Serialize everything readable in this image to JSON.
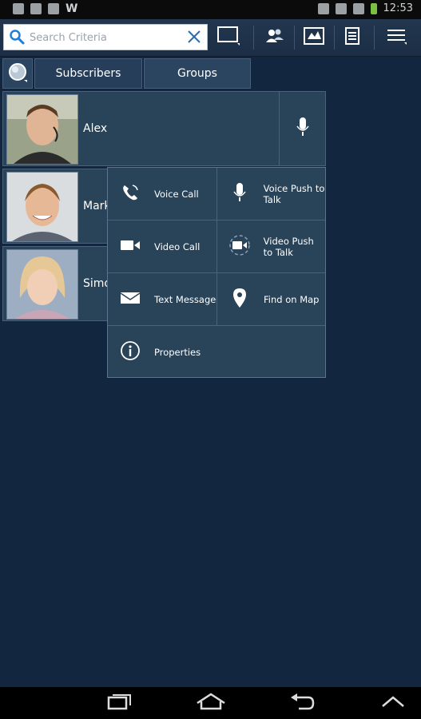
{
  "status_bar": {
    "time": "12:53"
  },
  "search": {
    "placeholder": "Search Criteria",
    "value": ""
  },
  "toolbar": {
    "buttons": [
      "window-icon",
      "people-icon",
      "map-icon",
      "list-icon",
      "menu-icon"
    ]
  },
  "tabs": [
    {
      "label": "Subscribers",
      "active": true
    },
    {
      "label": "Groups",
      "active": false
    }
  ],
  "subscribers": [
    {
      "name": "Alex"
    },
    {
      "name": "Mark"
    },
    {
      "name": "Simo"
    }
  ],
  "context_menu": {
    "items": [
      {
        "label": "Voice Call",
        "icon": "phone-icon"
      },
      {
        "label": "Voice Push to Talk",
        "icon": "microphone-icon"
      },
      {
        "label": "Video Call",
        "icon": "video-camera-icon"
      },
      {
        "label": "Video Push to Talk",
        "icon": "video-ptt-icon"
      },
      {
        "label": "Text Message",
        "icon": "envelope-icon"
      },
      {
        "label": "Find on Map",
        "icon": "map-pin-icon"
      },
      {
        "label": "Properties",
        "icon": "info-icon"
      }
    ]
  },
  "colors": {
    "background": "#13263f",
    "panel": "#294359",
    "border": "#4a627b",
    "accent_search_icon": "#1e7fd8"
  }
}
